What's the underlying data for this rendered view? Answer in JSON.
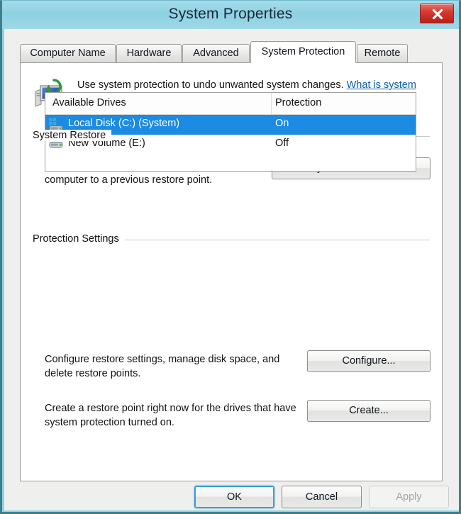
{
  "window": {
    "title": "System Properties",
    "close_label": "x",
    "frame_color": "#3e7f8c",
    "titlebar_color": "#8ed1e2",
    "close_color": "#d63b33"
  },
  "tabs": [
    {
      "label": "Computer Name",
      "active": false
    },
    {
      "label": "Hardware",
      "active": false
    },
    {
      "label": "Advanced",
      "active": false
    },
    {
      "label": "System Protection",
      "active": true
    },
    {
      "label": "Remote",
      "active": false
    }
  ],
  "intro": {
    "icon": "system-protection-icon",
    "text": "Use system protection to undo unwanted system changes. ",
    "link_text": "What is system protection?",
    "link_color": "#0a5fb0"
  },
  "system_restore": {
    "group_label": "System Restore",
    "description": "You can undo system changes by reverting your computer to a previous restore point.",
    "button_label": "System Restore..."
  },
  "protection_settings": {
    "group_label": "Protection Settings",
    "columns": [
      "Available Drives",
      "Protection"
    ],
    "selection_color": "#1d8ae3",
    "drives": [
      {
        "name": "Local Disk (C:) (System)",
        "protection": "On",
        "icon": "system-drive-icon",
        "selected": true
      },
      {
        "name": "New Volume (E:)",
        "protection": "Off",
        "icon": "drive-icon",
        "selected": false
      }
    ],
    "configure": {
      "description": "Configure restore settings, manage disk space, and delete restore points.",
      "button_label": "Configure..."
    },
    "create": {
      "description": "Create a restore point right now for the drives that have system protection turned on.",
      "button_label": "Create..."
    }
  },
  "footer": {
    "ok_label": "OK",
    "cancel_label": "Cancel",
    "apply_label": "Apply",
    "apply_disabled": true
  }
}
